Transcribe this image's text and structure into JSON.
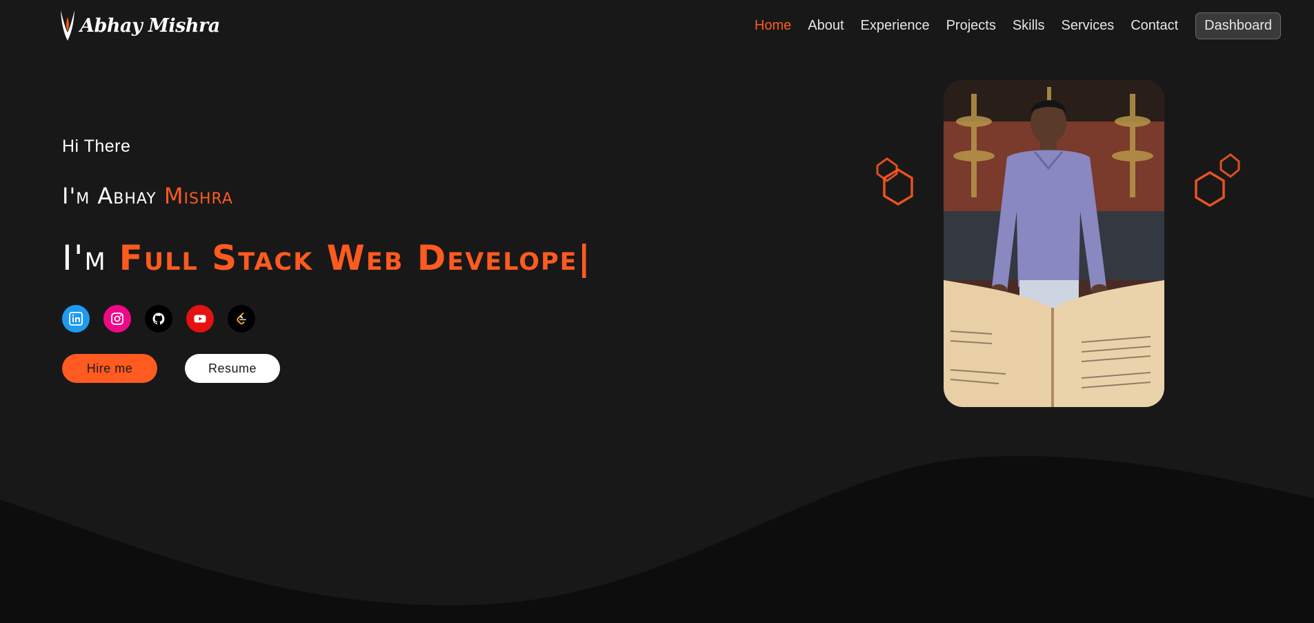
{
  "nav": {
    "brand": "Abhay Mishra",
    "links": [
      {
        "label": "Home",
        "active": true
      },
      {
        "label": "About"
      },
      {
        "label": "Experience"
      },
      {
        "label": "Projects"
      },
      {
        "label": "Skills"
      },
      {
        "label": "Services"
      },
      {
        "label": "Contact"
      }
    ],
    "dashboard_label": "Dashboard"
  },
  "hero": {
    "greeting": "Hi There",
    "intro_prefix": "I'm ",
    "intro_first": "Abhay ",
    "intro_name": "Mishra",
    "role_prefix": "I'm ",
    "role_text": "Full Stack Web Develope|"
  },
  "socials": [
    {
      "name": "linkedin",
      "color": "#1e9bf0"
    },
    {
      "name": "instagram",
      "color": "#ee0a87"
    },
    {
      "name": "github",
      "color": "#000000"
    },
    {
      "name": "youtube",
      "color": "#e51212"
    },
    {
      "name": "leetcode",
      "color": "#000000"
    }
  ],
  "buttons": {
    "hire": "Hire me",
    "resume": "Resume"
  },
  "colors": {
    "accent": "#ff5a1f",
    "background": "#181818",
    "wave": "#0d0d0d"
  }
}
